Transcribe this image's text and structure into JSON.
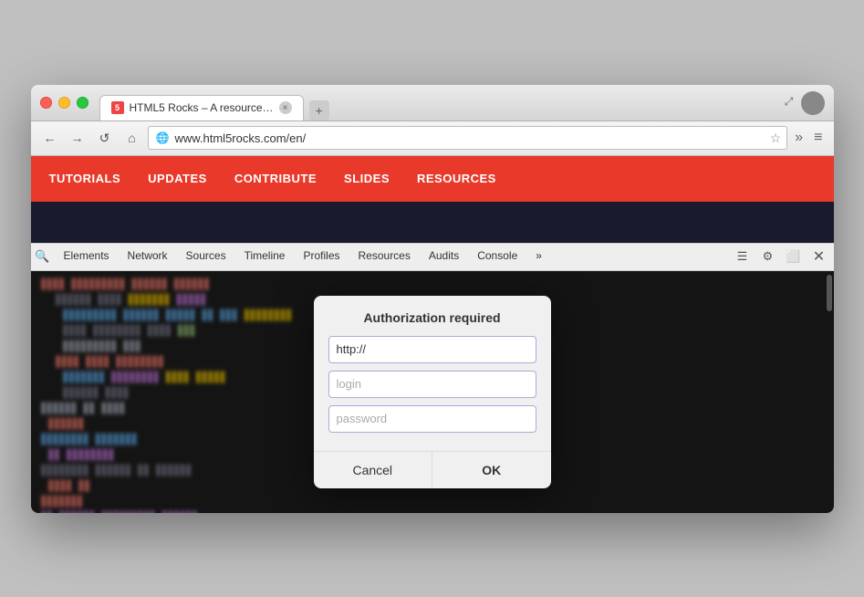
{
  "window": {
    "title": "HTML5 Rocks – A resource…",
    "url": "www.html5rocks.com/en/"
  },
  "traffic_lights": {
    "close": "close",
    "minimize": "minimize",
    "maximize": "maximize"
  },
  "nav": {
    "back_label": "←",
    "forward_label": "→",
    "reload_label": "↺",
    "home_label": "⌂",
    "overflow_label": "»",
    "menu_label": "≡"
  },
  "site_nav": {
    "items": [
      "TUTORIALS",
      "UPDATES",
      "CONTRIBUTE",
      "SLIDES",
      "RESOURCES"
    ]
  },
  "devtools": {
    "tabs": [
      "Elements",
      "Network",
      "Sources",
      "Timeline",
      "Profiles",
      "Resources",
      "Audits",
      "Console"
    ],
    "overflow_label": "»",
    "close_label": "✕"
  },
  "dialog": {
    "title": "Authorization required",
    "url_placeholder": "http://",
    "url_value": "http://",
    "login_placeholder": "login",
    "password_placeholder": "password",
    "cancel_label": "Cancel",
    "ok_label": "OK"
  }
}
